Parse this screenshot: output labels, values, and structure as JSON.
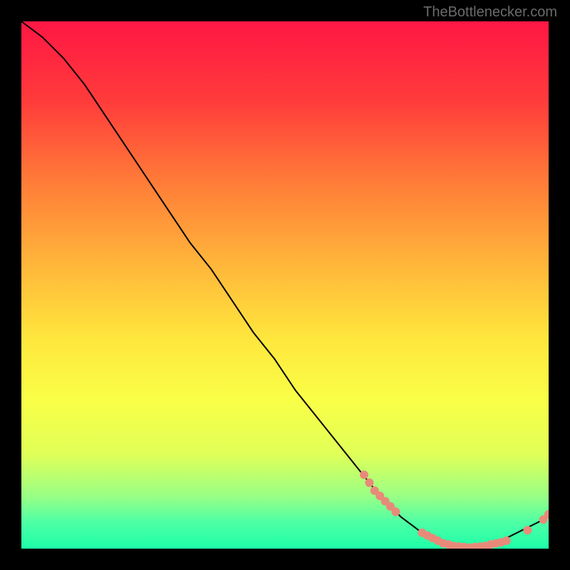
{
  "watermark": "TheBottlenecker.com",
  "chart_data": {
    "type": "line",
    "title": "",
    "xlabel": "",
    "ylabel": "",
    "xlim": [
      0,
      100
    ],
    "ylim": [
      0,
      100
    ],
    "gradient_background": {
      "stops": [
        {
          "pos": 0.0,
          "color": "#ff1744"
        },
        {
          "pos": 0.15,
          "color": "#ff3b3b"
        },
        {
          "pos": 0.3,
          "color": "#ff7a38"
        },
        {
          "pos": 0.45,
          "color": "#ffb23a"
        },
        {
          "pos": 0.6,
          "color": "#ffe63d"
        },
        {
          "pos": 0.72,
          "color": "#f9ff47"
        },
        {
          "pos": 0.82,
          "color": "#e0ff57"
        },
        {
          "pos": 0.9,
          "color": "#9aff85"
        },
        {
          "pos": 0.95,
          "color": "#4effa5"
        },
        {
          "pos": 1.0,
          "color": "#1effa8"
        }
      ]
    },
    "series": [
      {
        "name": "bottleneck-curve",
        "color": "#000000",
        "x": [
          0,
          4,
          8,
          12,
          16,
          20,
          24,
          28,
          32,
          36,
          40,
          44,
          48,
          52,
          56,
          60,
          64,
          68,
          72,
          76,
          80,
          84,
          88,
          92,
          96,
          100
        ],
        "y": [
          100,
          97,
          93,
          88,
          82,
          76,
          70,
          64,
          58,
          53,
          47,
          41,
          36,
          30,
          25,
          20,
          15,
          10,
          6,
          3,
          1,
          0,
          0.5,
          2,
          4,
          6
        ]
      }
    ],
    "scatter_points": {
      "name": "highlight-dots",
      "color": "#e88a7a",
      "radius": 6,
      "points": [
        {
          "x": 65,
          "y": 14
        },
        {
          "x": 66,
          "y": 12.5
        },
        {
          "x": 67,
          "y": 11
        },
        {
          "x": 68,
          "y": 10
        },
        {
          "x": 69,
          "y": 9
        },
        {
          "x": 70,
          "y": 8
        },
        {
          "x": 71,
          "y": 7
        },
        {
          "x": 76,
          "y": 3
        },
        {
          "x": 77,
          "y": 2.5
        },
        {
          "x": 78,
          "y": 2
        },
        {
          "x": 79,
          "y": 1.5
        },
        {
          "x": 80,
          "y": 1
        },
        {
          "x": 81,
          "y": 0.8
        },
        {
          "x": 82,
          "y": 0.5
        },
        {
          "x": 83,
          "y": 0.4
        },
        {
          "x": 84,
          "y": 0.3
        },
        {
          "x": 85,
          "y": 0.2
        },
        {
          "x": 86,
          "y": 0.3
        },
        {
          "x": 87,
          "y": 0.4
        },
        {
          "x": 88,
          "y": 0.5
        },
        {
          "x": 89,
          "y": 0.8
        },
        {
          "x": 90,
          "y": 1
        },
        {
          "x": 91,
          "y": 1.2
        },
        {
          "x": 92,
          "y": 1.5
        },
        {
          "x": 96,
          "y": 3.5
        },
        {
          "x": 99,
          "y": 5.5
        },
        {
          "x": 100,
          "y": 6.5
        }
      ]
    }
  }
}
